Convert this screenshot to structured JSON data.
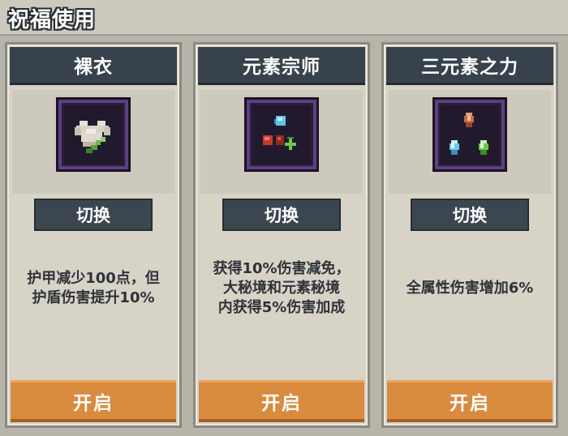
{
  "header": {
    "title": "祝福使用"
  },
  "cards": [
    {
      "name": "裸衣",
      "icon": "cloth-shirt-icon",
      "switch_label": "切换",
      "description": "护甲减少100点，但\n护盾伤害提升10%",
      "open_label": "开启"
    },
    {
      "name": "元素宗师",
      "icon": "element-orbs-icon",
      "switch_label": "切换",
      "description": "获得10%伤害减免，\n大秘境和元素秘境\n内获得5%伤害加成",
      "open_label": "开启"
    },
    {
      "name": "三元素之力",
      "icon": "three-crystals-icon",
      "switch_label": "切换",
      "description": "全属性伤害增加6%",
      "open_label": "开启"
    }
  ],
  "colors": {
    "header_bg": "#37424c",
    "open_button": "#d98b3f",
    "card_bg": "#d7d3c7",
    "icon_frame": "#5c3f84"
  }
}
